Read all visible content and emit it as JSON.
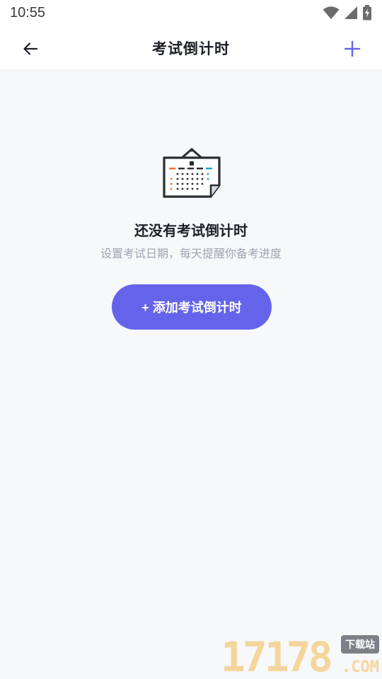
{
  "status_bar": {
    "time": "10:55"
  },
  "nav": {
    "title": "考试倒计时",
    "accent_color": "#6563ea"
  },
  "empty_state": {
    "title": "还没有考试倒计时",
    "subtitle": "设置考试日期，每天提醒你备考进度",
    "button_label": "+ 添加考试倒计时",
    "illustration_icon": "calendar-icon"
  },
  "watermark": {
    "number": "17178",
    "tag": "下载站",
    "suffix": ".COM"
  }
}
